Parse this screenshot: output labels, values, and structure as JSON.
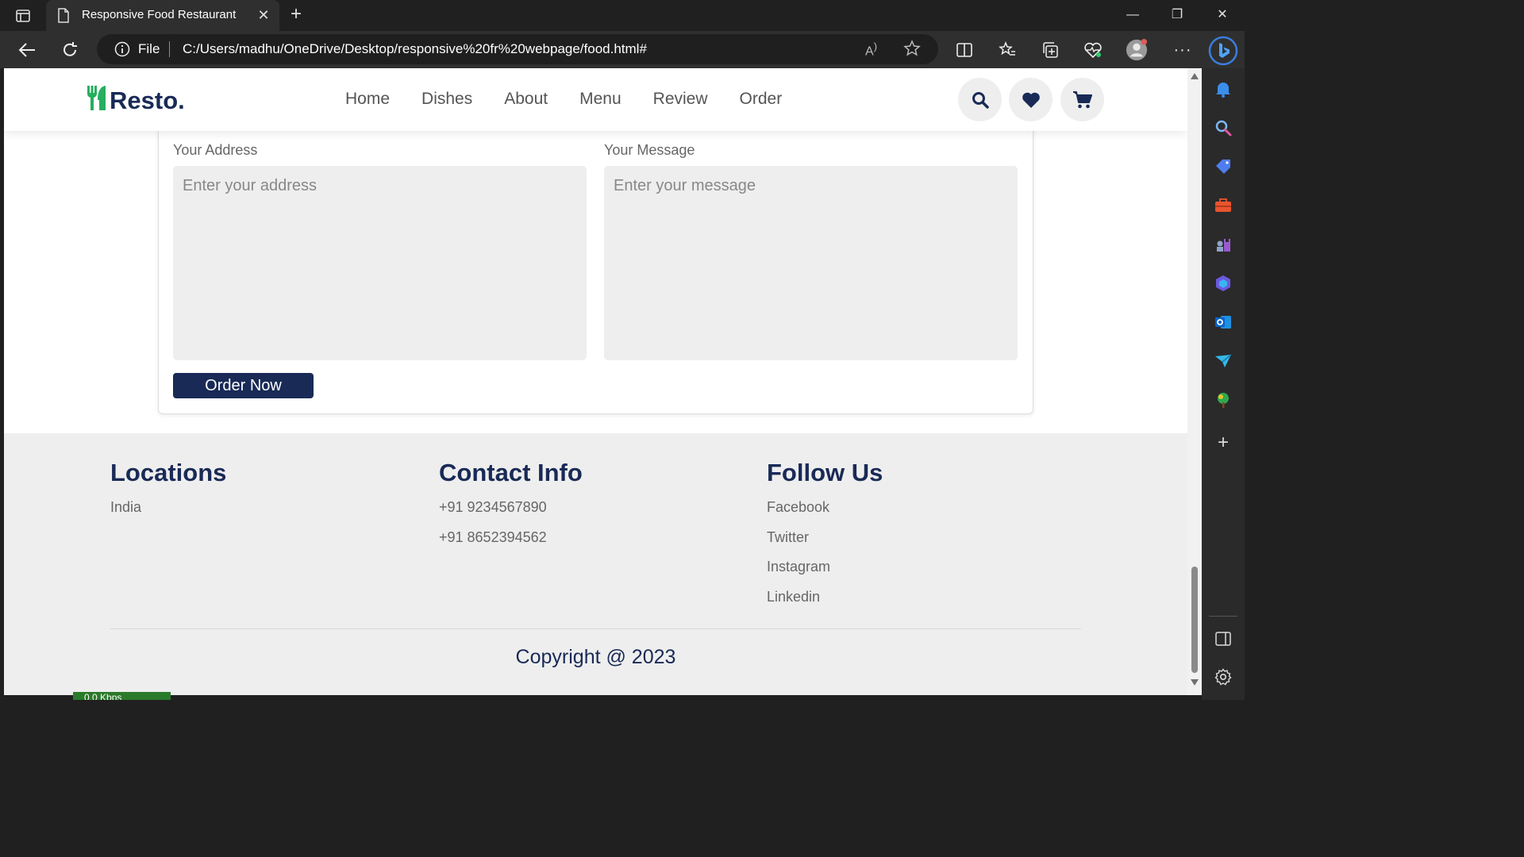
{
  "browser": {
    "tab_title": "Responsive Food Restaurant",
    "address_scheme": "File",
    "url": "C:/Users/madhu/OneDrive/Desktop/responsive%20fr%20webpage/food.html#"
  },
  "site": {
    "logo_text": "Resto.",
    "nav": [
      "Home",
      "Dishes",
      "About",
      "Menu",
      "Review",
      "Order"
    ],
    "accent_color": "#192a56",
    "logo_icon_color": "#27ae60"
  },
  "order_form": {
    "address_label": "Your Address",
    "address_placeholder": "Enter your address",
    "message_label": "Your Message",
    "message_placeholder": "Enter your message",
    "submit_label": "Order Now"
  },
  "footer": {
    "locations": {
      "title": "Locations",
      "items": [
        "India"
      ]
    },
    "contact": {
      "title": "Contact Info",
      "items": [
        "+91 9234567890",
        "+91 8652394562"
      ]
    },
    "follow": {
      "title": "Follow Us",
      "items": [
        "Facebook",
        "Twitter",
        "Instagram",
        "Linkedin"
      ]
    },
    "copyright": "Copyright @ 2023"
  },
  "taskbar": {
    "netspeed": "0.0 Kbps"
  }
}
